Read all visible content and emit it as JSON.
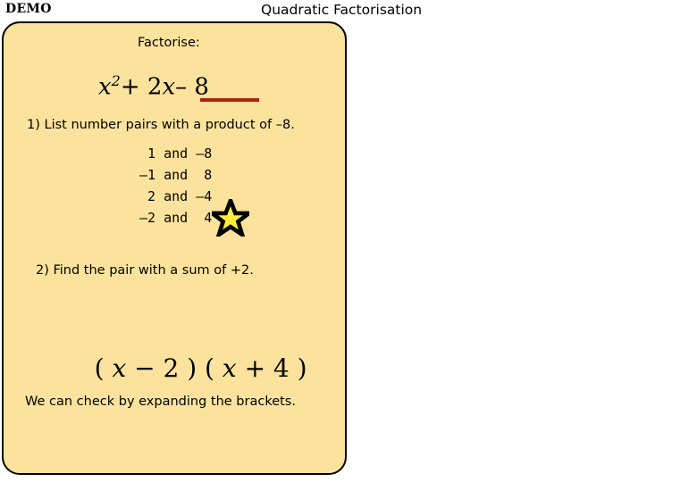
{
  "header": {
    "demo_badge": "DEMO",
    "title": "Quadratic Factorisation"
  },
  "card": {
    "prompt_label": "Factorise:",
    "expression": {
      "base_var": "x",
      "exponent": "2",
      "middle_term": "+ 2",
      "middle_var": "x",
      "constant_term": "– 8",
      "underline_color": "#aa2211"
    },
    "step_one": {
      "text": "1) List number pairs with a product of –8.",
      "pairs": [
        " 1 and –8",
        "–1 and  8",
        " 2 and –4",
        "–2 and  4"
      ],
      "highlight_icon": "star-icon",
      "highlight_pair_index": 3,
      "star_fill": "#ffed3a",
      "star_stroke": "#000000"
    },
    "step_two": {
      "text": "2) Find the pair with a sum of +2."
    },
    "factored_form": {
      "open_1": "( ",
      "var_1": "x",
      "op_1": " − 2 ",
      "close_1": ") ",
      "open_2": "( ",
      "var_2": "x",
      "op_2": " + 4 ",
      "close_2": ")"
    },
    "closing_note": "We can check by expanding the brackets.",
    "background_color": "#fbe39d",
    "border_color": "#000000"
  }
}
